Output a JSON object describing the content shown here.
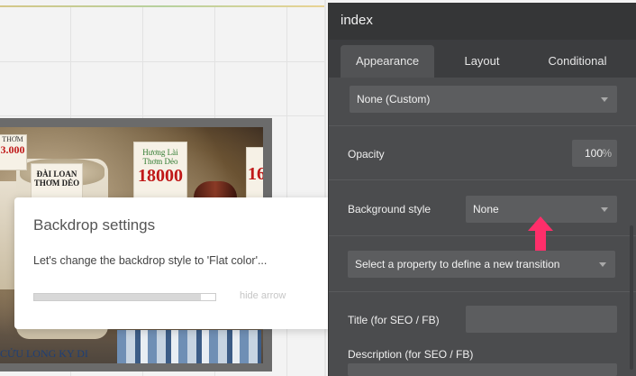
{
  "panel": {
    "title": "index",
    "tabs": [
      {
        "label": "Appearance",
        "active": true
      },
      {
        "label": "Layout",
        "active": false
      },
      {
        "label": "Conditional",
        "active": false
      }
    ],
    "style_select": {
      "value": "None (Custom)"
    },
    "opacity": {
      "label": "Opacity",
      "value": "100",
      "unit": "%"
    },
    "background_style": {
      "label": "Background style",
      "value": "None"
    },
    "transition_select": {
      "value": "Select a property to define a new transition"
    },
    "seo_title": {
      "label": "Title (for SEO / FB)",
      "value": ""
    },
    "seo_description": {
      "label": "Description (for SEO / FB)",
      "value": ""
    }
  },
  "tooltip": {
    "title": "Backdrop settings",
    "body": "Let's change the backdrop style to 'Flat color'...",
    "progress": 0.92,
    "hide_label": "hide arrow"
  },
  "image": {
    "sign_1": {
      "top": "Hương Lài",
      "mid": "Thơm Dẻo",
      "price": "18000"
    },
    "sign_2": {
      "top": "ĐÀI LOAN",
      "mid": "THƠM DẺO"
    },
    "sign_3_price": "16",
    "sign_left": {
      "top": "THƠM",
      "price": "3.000"
    },
    "bag_text": "CỬU LONG KY DI"
  },
  "colors": {
    "panel_bg": "#4b4c4e",
    "header_bg": "#353637",
    "accent_arrow": "#ff2e6a"
  },
  "icons": [
    "caret-down-icon",
    "arrow-up-icon"
  ]
}
